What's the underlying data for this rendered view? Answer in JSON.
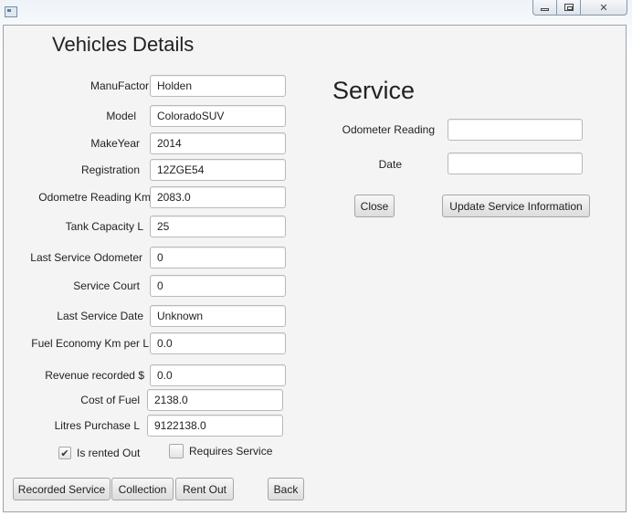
{
  "window": {
    "icon": "window-app-icon",
    "controls": {
      "minimize": "minimize-icon",
      "maximize": "maximize-icon",
      "close": "close-icon",
      "close_glyph": "✕"
    }
  },
  "vehicle": {
    "title": "Vehicles Details",
    "fields": {
      "manufactor": {
        "label": "ManuFactor",
        "value": "Holden"
      },
      "model": {
        "label": "Model",
        "value": "ColoradoSUV"
      },
      "make_year": {
        "label": "MakeYear",
        "value": "2014"
      },
      "registration": {
        "label": "Registration",
        "value": "12ZGE54"
      },
      "odometer": {
        "label": "Odometre Reading Km",
        "value": "2083.0"
      },
      "tank_capacity": {
        "label": "Tank Capacity L",
        "value": "25"
      },
      "last_service_odometer": {
        "label": "Last Service Odometer",
        "value": "0"
      },
      "service_count": {
        "label": "Service Court",
        "value": "0"
      },
      "last_service_date": {
        "label": "Last Service Date",
        "value": "Unknown"
      },
      "fuel_economy": {
        "label": "Fuel Economy Km per L",
        "value": "0.0"
      },
      "revenue": {
        "label": "Revenue recorded $",
        "value": "0.0"
      },
      "cost_of_fuel": {
        "label": "Cost of Fuel",
        "value": "2138.0"
      },
      "litres_purchase": {
        "label": "Litres Purchase L",
        "value": "9122138.0"
      }
    },
    "checkboxes": {
      "is_rented_out": {
        "label": "Is rented Out",
        "checked": true,
        "check_glyph": "✔"
      },
      "requires_service": {
        "label": "Requires Service",
        "checked": false,
        "check_glyph": ""
      }
    },
    "buttons": {
      "recorded_service": "Recorded Service",
      "collection": "Collection",
      "rent_out": "Rent Out",
      "back": "Back"
    }
  },
  "service": {
    "title": "Service",
    "odometer_label": "Odometer Reading",
    "odometer_value": "",
    "date_label": "Date",
    "date_value": "",
    "close_button": "Close",
    "update_button": "Update Service Information"
  }
}
